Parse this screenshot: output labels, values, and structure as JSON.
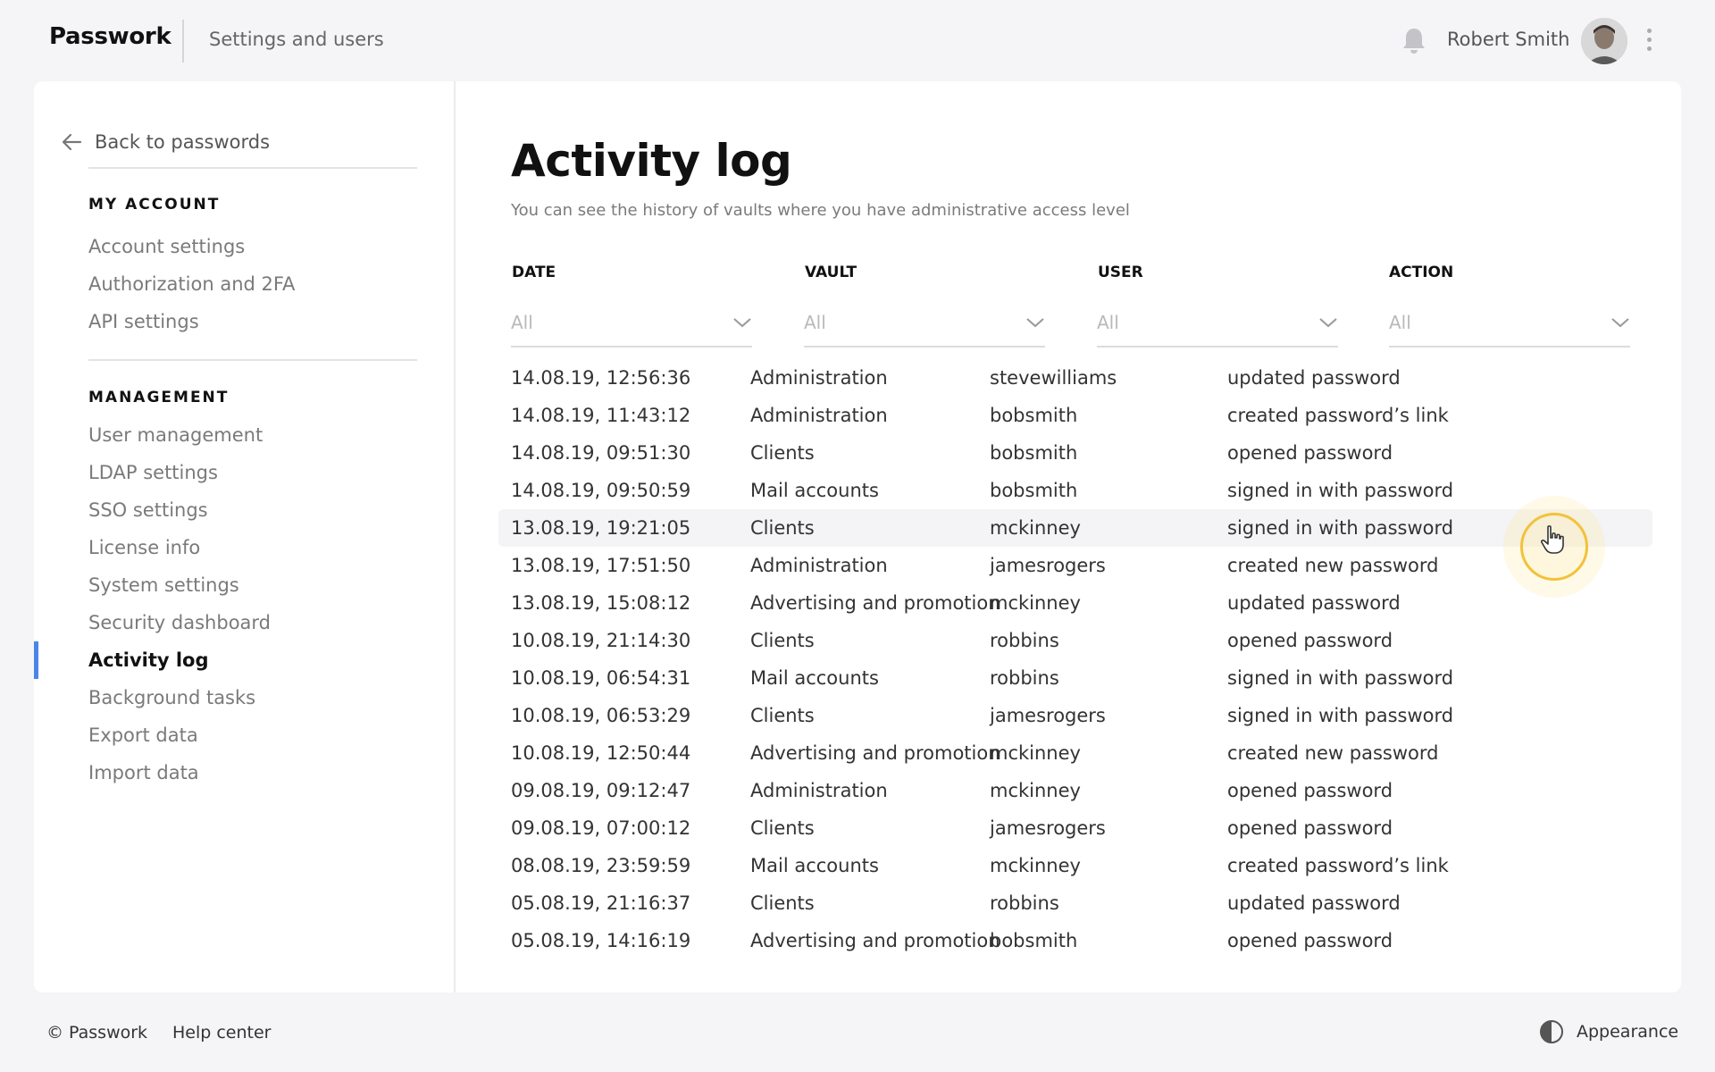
{
  "header": {
    "logo": "Passwork",
    "subtitle": "Settings and users",
    "username": "Robert Smith",
    "icons": {
      "notifications": "bell-icon",
      "menu": "kebab-menu-icon"
    }
  },
  "sidebar": {
    "back_label": "Back to passwords",
    "my_account_title": "MY ACCOUNT",
    "my_account_items": [
      "Account settings",
      "Authorization and 2FA",
      "API settings"
    ],
    "management_title": "MANAGEMENT",
    "management_items": [
      "User management",
      "LDAP settings",
      "SSO settings",
      "License info",
      "System settings",
      "Security dashboard",
      "Activity log",
      "Background tasks",
      "Export data",
      "Import data"
    ],
    "active_item": "Activity log",
    "accent_color": "#4a86e8"
  },
  "main": {
    "title": "Activity log",
    "subtitle": "You can see the history of vaults where you have administrative access level",
    "columns": [
      "DATE",
      "VAULT",
      "USER",
      "ACTION"
    ],
    "filters": [
      "All",
      "All",
      "All",
      "All"
    ],
    "rows": [
      [
        "14.08.19, 12:56:36",
        "Administration",
        "stevewilliams",
        "updated password"
      ],
      [
        "14.08.19, 11:43:12",
        "Administration",
        "bobsmith",
        "created password’s link"
      ],
      [
        "14.08.19, 09:51:30",
        "Clients",
        "bobsmith",
        "opened password"
      ],
      [
        "14.08.19, 09:50:59",
        "Mail accounts",
        "bobsmith",
        "signed in with password"
      ],
      [
        "13.08.19, 19:21:05",
        "Clients",
        "mckinney",
        "signed in with password"
      ],
      [
        "13.08.19, 17:51:50",
        "Administration",
        "jamesrogers",
        "created new password"
      ],
      [
        "13.08.19, 15:08:12",
        "Advertising and promotion",
        "mckinney",
        "updated password"
      ],
      [
        "10.08.19, 21:14:30",
        "Clients",
        "robbins",
        "opened password"
      ],
      [
        "10.08.19, 06:54:31",
        "Mail accounts",
        "robbins",
        "signed in with password"
      ],
      [
        "10.08.19, 06:53:29",
        "Clients",
        "jamesrogers",
        "signed in with password"
      ],
      [
        "10.08.19, 12:50:44",
        "Advertising and promotion",
        "mckinney",
        "created new password"
      ],
      [
        "09.08.19, 09:12:47",
        "Administration",
        "mckinney",
        "opened password"
      ],
      [
        "09.08.19, 07:00:12",
        "Clients",
        "jamesrogers",
        "opened password"
      ],
      [
        "08.08.19, 23:59:59",
        "Mail accounts",
        "mckinney",
        "created password’s link"
      ],
      [
        "05.08.19, 21:16:37",
        "Clients",
        "robbins",
        "updated password"
      ],
      [
        "05.08.19, 14:16:19",
        "Advertising and promotion",
        "bobsmith",
        "opened password"
      ]
    ],
    "hovered_row": 4
  },
  "footer": {
    "copyright": "© Passwork",
    "help": "Help center",
    "appearance": "Appearance"
  }
}
